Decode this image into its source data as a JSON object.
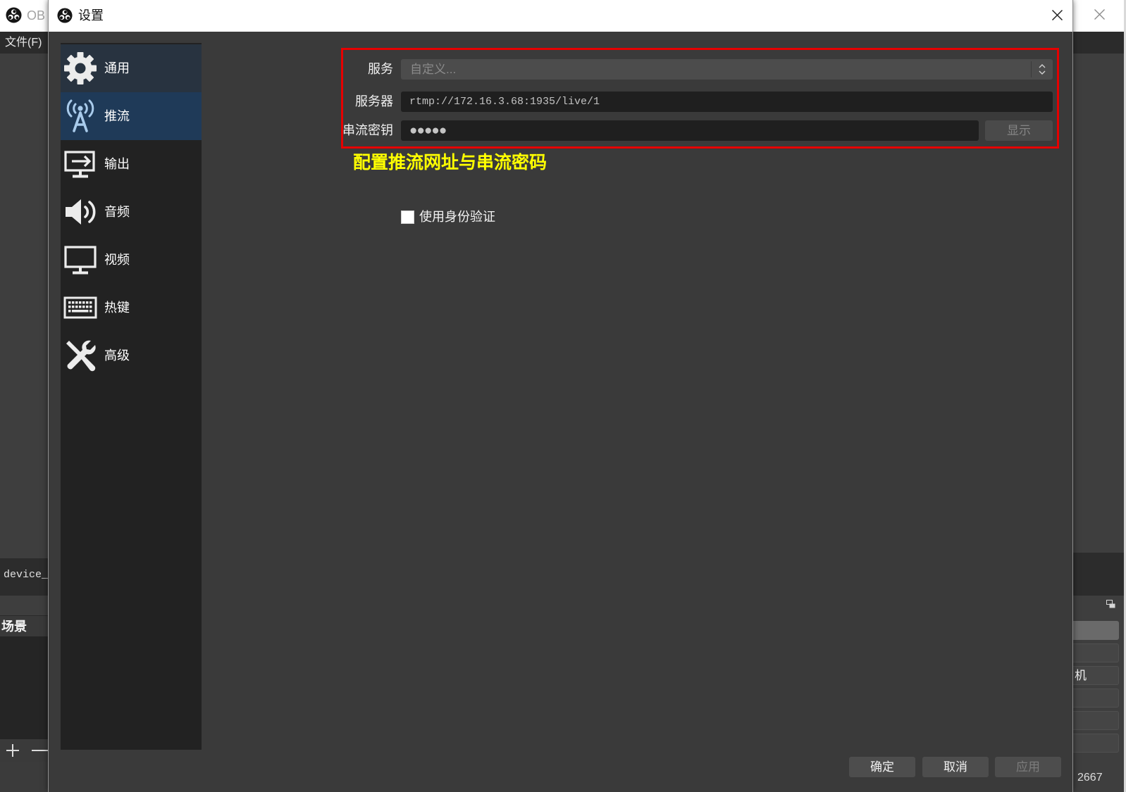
{
  "main_window": {
    "title": "OB",
    "logo_icon": "obs-logo-icon",
    "close_icon": "close-icon",
    "menu_file": "文件(F)",
    "source_item": "device_",
    "scenes_header": "场景",
    "scenes_add_icon": "plus-icon",
    "scenes_remove_icon": "minus-icon",
    "dock_float_icon": "float-dock-icon",
    "controls_partial_label": "机",
    "status_value": "2667"
  },
  "dialog": {
    "title": "设置",
    "logo_icon": "obs-logo-icon",
    "close_icon": "close-icon"
  },
  "sidebar": {
    "hovered_index": 0,
    "selected_index": 1,
    "items": [
      {
        "label": "通用",
        "icon": "gear-icon"
      },
      {
        "label": "推流",
        "icon": "broadcast-antenna-icon"
      },
      {
        "label": "输出",
        "icon": "output-monitor-icon"
      },
      {
        "label": "音频",
        "icon": "speaker-icon"
      },
      {
        "label": "视频",
        "icon": "monitor-icon"
      },
      {
        "label": "热键",
        "icon": "keyboard-icon"
      },
      {
        "label": "高级",
        "icon": "tools-icon"
      }
    ]
  },
  "stream": {
    "service_label": "服务",
    "service_value": "自定义...",
    "service_spinner_icon": "chevron-up-down-icon",
    "server_label": "服务器",
    "server_value": "rtmp://172.16.3.68:1935/live/1",
    "stream_key_label": "串流密钥",
    "stream_key_masked": "●●●●●",
    "show_key_button": "显示",
    "auth_label": "使用身份验证",
    "auth_checked": false
  },
  "annotation": {
    "text": "配置推流网址与串流密码"
  },
  "footer": {
    "ok": "确定",
    "cancel": "取消",
    "apply": "应用"
  },
  "colors": {
    "highlight_box": "#e60000",
    "annotation_text": "#ffff00",
    "selected_item_bg": "#1f3a58",
    "hovered_item_bg": "#283340",
    "sidebar_bg": "#222222",
    "dialog_bg": "#3a3a3a",
    "input_bg": "#1f1f1f"
  }
}
